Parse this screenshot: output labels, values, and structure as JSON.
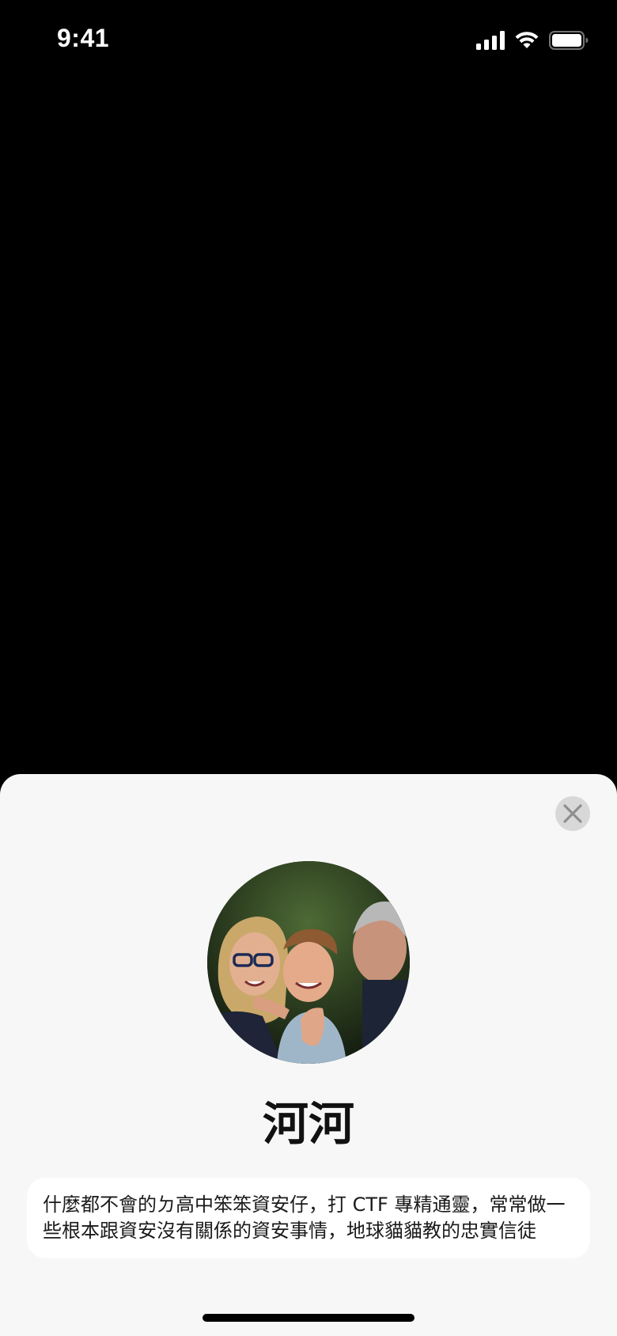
{
  "status_bar": {
    "time": "9:41",
    "icons": [
      "signal-icon",
      "wifi-icon",
      "battery-icon"
    ]
  },
  "sheet": {
    "close_icon": "close-icon",
    "avatar": "family-photo",
    "name": "河河",
    "bio": "什麼都不會的ㄉ高中笨笨資安仔，打 CTF 專精通靈，常常做一些根本跟資安沒有關係的資安事情，地球貓貓教的忠實信徒"
  },
  "colors": {
    "background": "#000000",
    "sheet": "#f7f7f7",
    "card": "#ffffff",
    "close_button": "#d8d8d8",
    "text": "#111111"
  }
}
